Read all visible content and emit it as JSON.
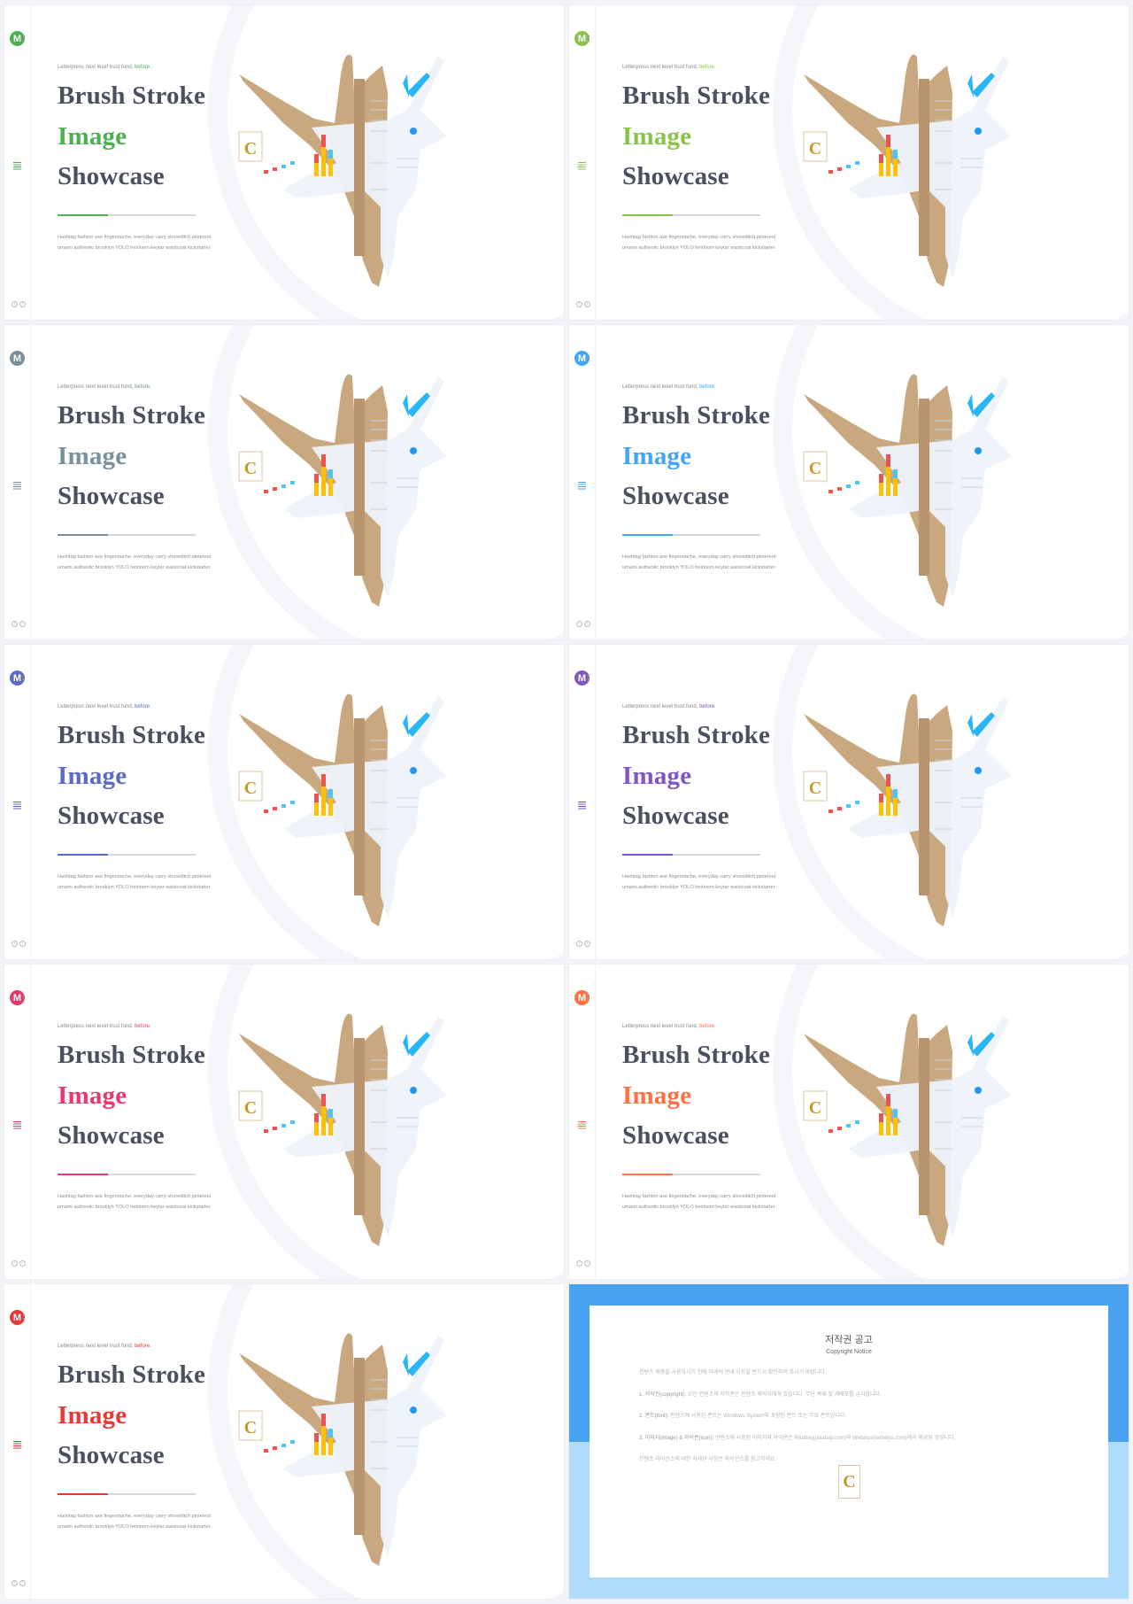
{
  "slides": [
    {
      "tagline": "Letterpress next level trust fund,",
      "tagline_accent": "before.",
      "line1": "Brush Stroke",
      "line2": "Image",
      "line3": "Showcase",
      "desc1": "Hashtag fashion axe fingerstache, everyday carry shoreditch pinterest",
      "desc2": "umami authentic brooklyn YOLO heirloom keytar waistcoat kickstarter.",
      "accent": "#4caf50",
      "logo": "M"
    },
    {
      "tagline": "Letterpress next level trust fund,",
      "tagline_accent": "before.",
      "line1": "Brush Stroke",
      "line2": "Image",
      "line3": "Showcase",
      "desc1": "Hashtag fashion axe fingerstache, everyday carry shoreditch pinterest",
      "desc2": "umami authentic brooklyn YOLO heirloom keytar waistcoat kickstarter.",
      "accent": "#8bc34a",
      "logo": "M"
    },
    {
      "tagline": "Letterpress next level trust fund,",
      "tagline_accent": "before.",
      "line1": "Brush Stroke",
      "line2": "Image",
      "line3": "Showcase",
      "desc1": "Hashtag fashion axe fingerstache, everyday carry shoreditch pinterest",
      "desc2": "umami authentic brooklyn YOLO heirloom keytar waistcoat kickstarter.",
      "accent": "#78909c",
      "logo": "M"
    },
    {
      "tagline": "Letterpress next level trust fund,",
      "tagline_accent": "before.",
      "line1": "Brush Stroke",
      "line2": "Image",
      "line3": "Showcase",
      "desc1": "Hashtag fashion axe fingerstache, everyday carry shoreditch pinterest",
      "desc2": "umami authentic brooklyn YOLO heirloom keytar waistcoat kickstarter.",
      "accent": "#42a5f5",
      "logo": "M"
    },
    {
      "tagline": "Letterpress next level trust fund,",
      "tagline_accent": "before.",
      "line1": "Brush Stroke",
      "line2": "Image",
      "line3": "Showcase",
      "desc1": "Hashtag fashion axe fingerstache, everyday carry shoreditch pinterest",
      "desc2": "umami authentic brooklyn YOLO heirloom keytar waistcoat kickstarter.",
      "accent": "#5c6bc0",
      "logo": "M"
    },
    {
      "tagline": "Letterpress next level trust fund,",
      "tagline_accent": "before.",
      "line1": "Brush Stroke",
      "line2": "Image",
      "line3": "Showcase",
      "desc1": "Hashtag fashion axe fingerstache, everyday carry shoreditch pinterest",
      "desc2": "umami authentic brooklyn YOLO heirloom keytar waistcoat kickstarter.",
      "accent": "#7e57c2",
      "logo": "M"
    },
    {
      "tagline": "Letterpress next level trust fund,",
      "tagline_accent": "before.",
      "line1": "Brush Stroke",
      "line2": "Image",
      "line3": "Showcase",
      "desc1": "Hashtag fashion axe fingerstache, everyday carry shoreditch pinterest",
      "desc2": "umami authentic brooklyn YOLO heirloom keytar waistcoat kickstarter.",
      "accent": "#e5396e",
      "logo": "M"
    },
    {
      "tagline": "Letterpress next level trust fund,",
      "tagline_accent": "before.",
      "line1": "Brush Stroke",
      "line2": "Image",
      "line3": "Showcase",
      "desc1": "Hashtag fashion axe fingerstache, everyday carry shoreditch pinterest",
      "desc2": "umami authentic brooklyn YOLO heirloom keytar waistcoat kickstarter.",
      "accent": "#ff7043",
      "logo": "M"
    },
    {
      "tagline": "Letterpress next level trust fund,",
      "tagline_accent": "before.",
      "line1": "Brush Stroke",
      "line2": "Image",
      "line3": "Showcase",
      "desc1": "Hashtag fashion axe fingerstache, everyday carry shoreditch pinterest",
      "desc2": "umami authentic brooklyn YOLO heirloom keytar waistcoat kickstarter.",
      "accent": "#e53935",
      "logo": "M"
    }
  ],
  "copyright": {
    "title": "저작권 공고",
    "subtitle": "Copyright Notice",
    "intro": "컨텐츠 제품을 사용하시기 전에 아래의 안내 사항을 반드시 확인하여 주시기 바랍니다.",
    "p1_label": "1. 저작권(copyright):",
    "p1": "모든 컨텐츠의 저작권은 컨텐츠 제작자에게 있습니다. 무단 복제 및 재배포를 금지합니다.",
    "p2_label": "2. 폰트(font):",
    "p2": "컨텐츠에 사용된 폰트는 Windows System에 포함된 폰트 또는 무료 폰트입니다.",
    "p3_label": "3. 이미지(image) & 아이콘(icon):",
    "p3": "컨텐츠에 사용된 이미지와 아이콘은 Pixabay(pixabay.com)와 Webalys(webalys.com)에서 제공된 것입니다.",
    "outro": "컨텐츠 라이선스에 대한 자세한 사항은 라이선스를 참고하세요.",
    "badge": "C",
    "colors": {
      "top": "#4aa3f1",
      "bottom": "#aedcfa"
    }
  }
}
